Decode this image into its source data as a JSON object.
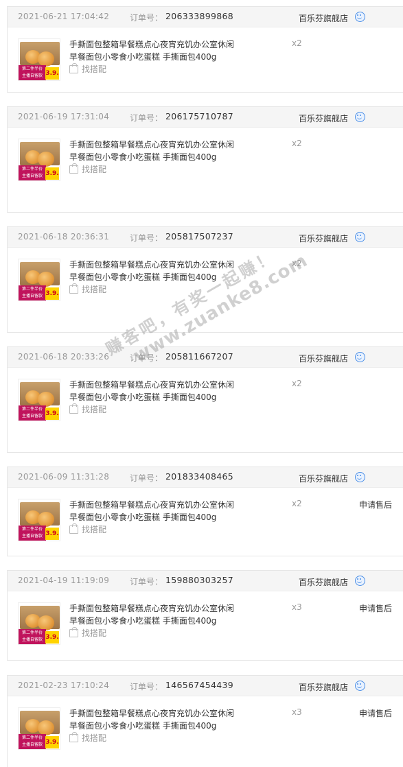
{
  "orders": [
    {
      "date": "2021-06-21 17:04:42",
      "order_no_label": "订单号：",
      "order_no": "206333899868",
      "shop": "百乐芬旗舰店",
      "title": "手撕面包整箱早餐糕点心夜宵充饥办公室休闲早餐面包小零食小吃蛋糕 手撕面包400g",
      "match": "找搭配",
      "qty": "x2",
      "after_sale": ""
    },
    {
      "date": "2021-06-19 17:31:04",
      "order_no_label": "订单号：",
      "order_no": "206175710787",
      "shop": "百乐芬旗舰店",
      "title": "手撕面包整箱早餐糕点心夜宵充饥办公室休闲早餐面包小零食小吃蛋糕 手撕面包400g",
      "match": "找搭配",
      "qty": "x2",
      "after_sale": ""
    },
    {
      "date": "2021-06-18 20:36:31",
      "order_no_label": "订单号：",
      "order_no": "205817507237",
      "shop": "百乐芬旗舰店",
      "title": "手撕面包整箱早餐糕点心夜宵充饥办公室休闲早餐面包小零食小吃蛋糕 手撕面包400g",
      "match": "找搭配",
      "qty": "x2",
      "after_sale": ""
    },
    {
      "date": "2021-06-18 20:33:26",
      "order_no_label": "订单号：",
      "order_no": "205811667207",
      "shop": "百乐芬旗舰店",
      "title": "手撕面包整箱早餐糕点心夜宵充饥办公室休闲早餐面包小零食小吃蛋糕 手撕面包400g",
      "match": "找搭配",
      "qty": "x2",
      "after_sale": ""
    },
    {
      "date": "2021-06-09 11:31:28",
      "order_no_label": "订单号：",
      "order_no": "201833408465",
      "shop": "百乐芬旗舰店",
      "title": "手撕面包整箱早餐糕点心夜宵充饥办公室休闲早餐面包小零食小吃蛋糕 手撕面包400g",
      "match": "找搭配",
      "qty": "x2",
      "after_sale": "申请售后"
    },
    {
      "date": "2021-04-19 11:19:09",
      "order_no_label": "订单号：",
      "order_no": "159880303257",
      "shop": "百乐芬旗舰店",
      "title": "手撕面包整箱早餐糕点心夜宵充饥办公室休闲早餐面包小零食小吃蛋糕 手撕面包400g",
      "match": "找搭配",
      "qty": "x3",
      "after_sale": "申请售后"
    },
    {
      "date": "2021-02-23 17:10:24",
      "order_no_label": "订单号：",
      "order_no": "146567454439",
      "shop": "百乐芬旗舰店",
      "title": "手撕面包整箱早餐糕点心夜宵充饥办公室休闲早餐面包小零食小吃蛋糕 手撕面包400g",
      "match": "找搭配",
      "qty": "x3",
      "after_sale": "申请售后"
    }
  ],
  "thumbnail": {
    "promo_line1": "第二件半价",
    "promo_line2": "主播自留款",
    "price": "3.9."
  },
  "watermark": {
    "line1": "赚客吧，有奖一起赚！",
    "line2": "www.zuanke8.com"
  },
  "icons": {
    "chat": "chat-icon",
    "match": "bag-icon"
  },
  "colors": {
    "header_bg": "#f5f5f5",
    "border": "#e6e6e6",
    "chat_blue": "#4a8ee6",
    "promo": "#c0135c",
    "price_bg": "#ffd300"
  }
}
